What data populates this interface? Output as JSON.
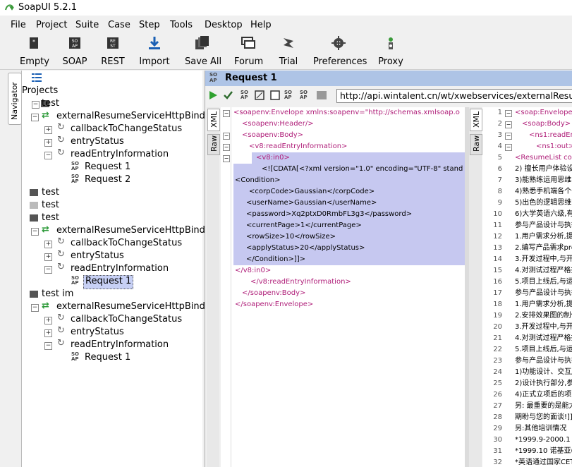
{
  "app": {
    "title": "SoapUI 5.2.1"
  },
  "menu": [
    "File",
    "Project",
    "Suite",
    "Case",
    "Step",
    "Tools",
    "Desktop",
    "Help"
  ],
  "toolbar": [
    "Empty",
    "SOAP",
    "REST",
    "Import",
    "Save All",
    "Forum",
    "Trial",
    "Preferences",
    "Proxy"
  ],
  "navigator": {
    "tab_label": "Navigator",
    "root": "Projects",
    "tree": [
      {
        "label": "test",
        "kind": "project"
      },
      {
        "label": "externalResumeServiceHttpBinding",
        "kind": "binding"
      },
      {
        "label": "callbackToChangeStatus",
        "kind": "operation"
      },
      {
        "label": "entryStatus",
        "kind": "operation"
      },
      {
        "label": "readEntryInformation",
        "kind": "operation"
      },
      {
        "label": "Request 1",
        "kind": "request"
      },
      {
        "label": "Request 2",
        "kind": "request"
      },
      {
        "label": "test",
        "kind": "project"
      },
      {
        "label": "test",
        "kind": "project-closed"
      },
      {
        "label": "test",
        "kind": "project"
      },
      {
        "label": "externalResumeServiceHttpBinding",
        "kind": "binding"
      },
      {
        "label": "callbackToChangeStatus",
        "kind": "operation"
      },
      {
        "label": "entryStatus",
        "kind": "operation"
      },
      {
        "label": "readEntryInformation",
        "kind": "operation"
      },
      {
        "label": "Request 1",
        "kind": "request",
        "selected": true
      },
      {
        "label": "test im",
        "kind": "project"
      },
      {
        "label": "externalResumeServiceHttpBinding",
        "kind": "binding"
      },
      {
        "label": "callbackToChangeStatus",
        "kind": "operation"
      },
      {
        "label": "entryStatus",
        "kind": "operation"
      },
      {
        "label": "readEntryInformation",
        "kind": "operation"
      },
      {
        "label": "Request 1",
        "kind": "request"
      }
    ]
  },
  "request": {
    "title": "Request 1",
    "url": "http://api.wintalent.cn/wt/xwebservices/externalResumeSe",
    "left_tabs": [
      "XML",
      "Raw"
    ],
    "right_tabs": [
      "XML",
      "Raw"
    ],
    "request_lines": [
      "<soapenv:Envelope xmlns:soapenv=\"http://schemas.xmlsoap.o",
      "<soapenv:Header/>",
      "<soapenv:Body>",
      "<v8:readEntryInformation>",
      "<v8:in0>",
      "<![CDATA[<?xml version=\"1.0\" encoding=\"UTF-8\" stand",
      "<Condition>",
      "<corpCode>Gaussian</corpCode>",
      "<userName>Gaussian</userName>",
      "<password>Xq2ptxD0RmbFL3g3</password>",
      "<currentPage>1</currentPage>",
      "<rowSize>10</rowSize>",
      "<applyStatus>20</applyStatus>",
      "</Condition>]]>",
      "</v8:in0>",
      "</v8:readEntryInformation>",
      "</soapenv:Body>",
      "</soapenv:Envelope>"
    ],
    "response_lines": [
      "<soap:Envelope xm",
      "<soap:Body>",
      "<ns1:readEntry",
      "<ns1:out><![C",
      "<ResumeList code=",
      "2) 擅长用户体验设",
      "3)能熟练运用思维导",
      "4)熟悉手机端各个平",
      "5)出色的逻辑思维能",
      "6)大学英语六级,有(",
      "参与产品设计与执行",
      "1.用户需求分析,提出",
      "2.编写产品需求prd,",
      "3.开发过程中,与开发",
      "4.对测试过程严格把",
      "5.项目上线后,与运营",
      "参与产品设计与执行",
      "1.用户需求分析,提出",
      "2.安排效果图的制作",
      "3.开发过程中,与开发",
      "4.对测试过程严格把",
      "5.项目上线后,与运营",
      "参与产品设计与执行",
      "1)功能设计、交互/",
      "2)设计执行部分,参与",
      "4)正式立项后的项目",
      "另: 最重要的是能大",
      "期盼与您的面谈!]]]",
      "另:其他培训情况",
      "*1999.9-2000.1 北京",
      "*1999.10 诺基亚(中",
      "*英语通过国家CET-"
    ]
  }
}
